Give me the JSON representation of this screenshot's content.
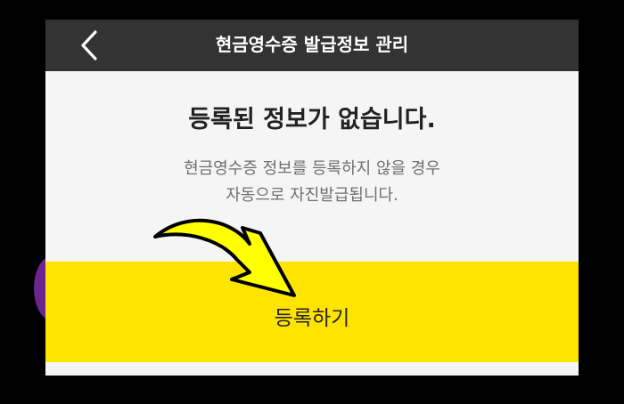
{
  "header": {
    "title": "현금영수증 발급정보 관리",
    "back_icon": "chevron-left-icon"
  },
  "empty_state": {
    "title": "등록된 정보가 없습니다.",
    "description_line1": "현금영수증 정보를 등록하지 않을 경우",
    "description_line2": "자동으로 자진발급됩니다."
  },
  "register_button": {
    "label": "등록하기"
  },
  "colors": {
    "header_bg": "#333333",
    "button_bg": "#ffe400",
    "arrow_fill": "#ffff00",
    "page_bg": "#f5f5f5"
  },
  "annotation": {
    "icon": "curved-arrow-icon"
  }
}
